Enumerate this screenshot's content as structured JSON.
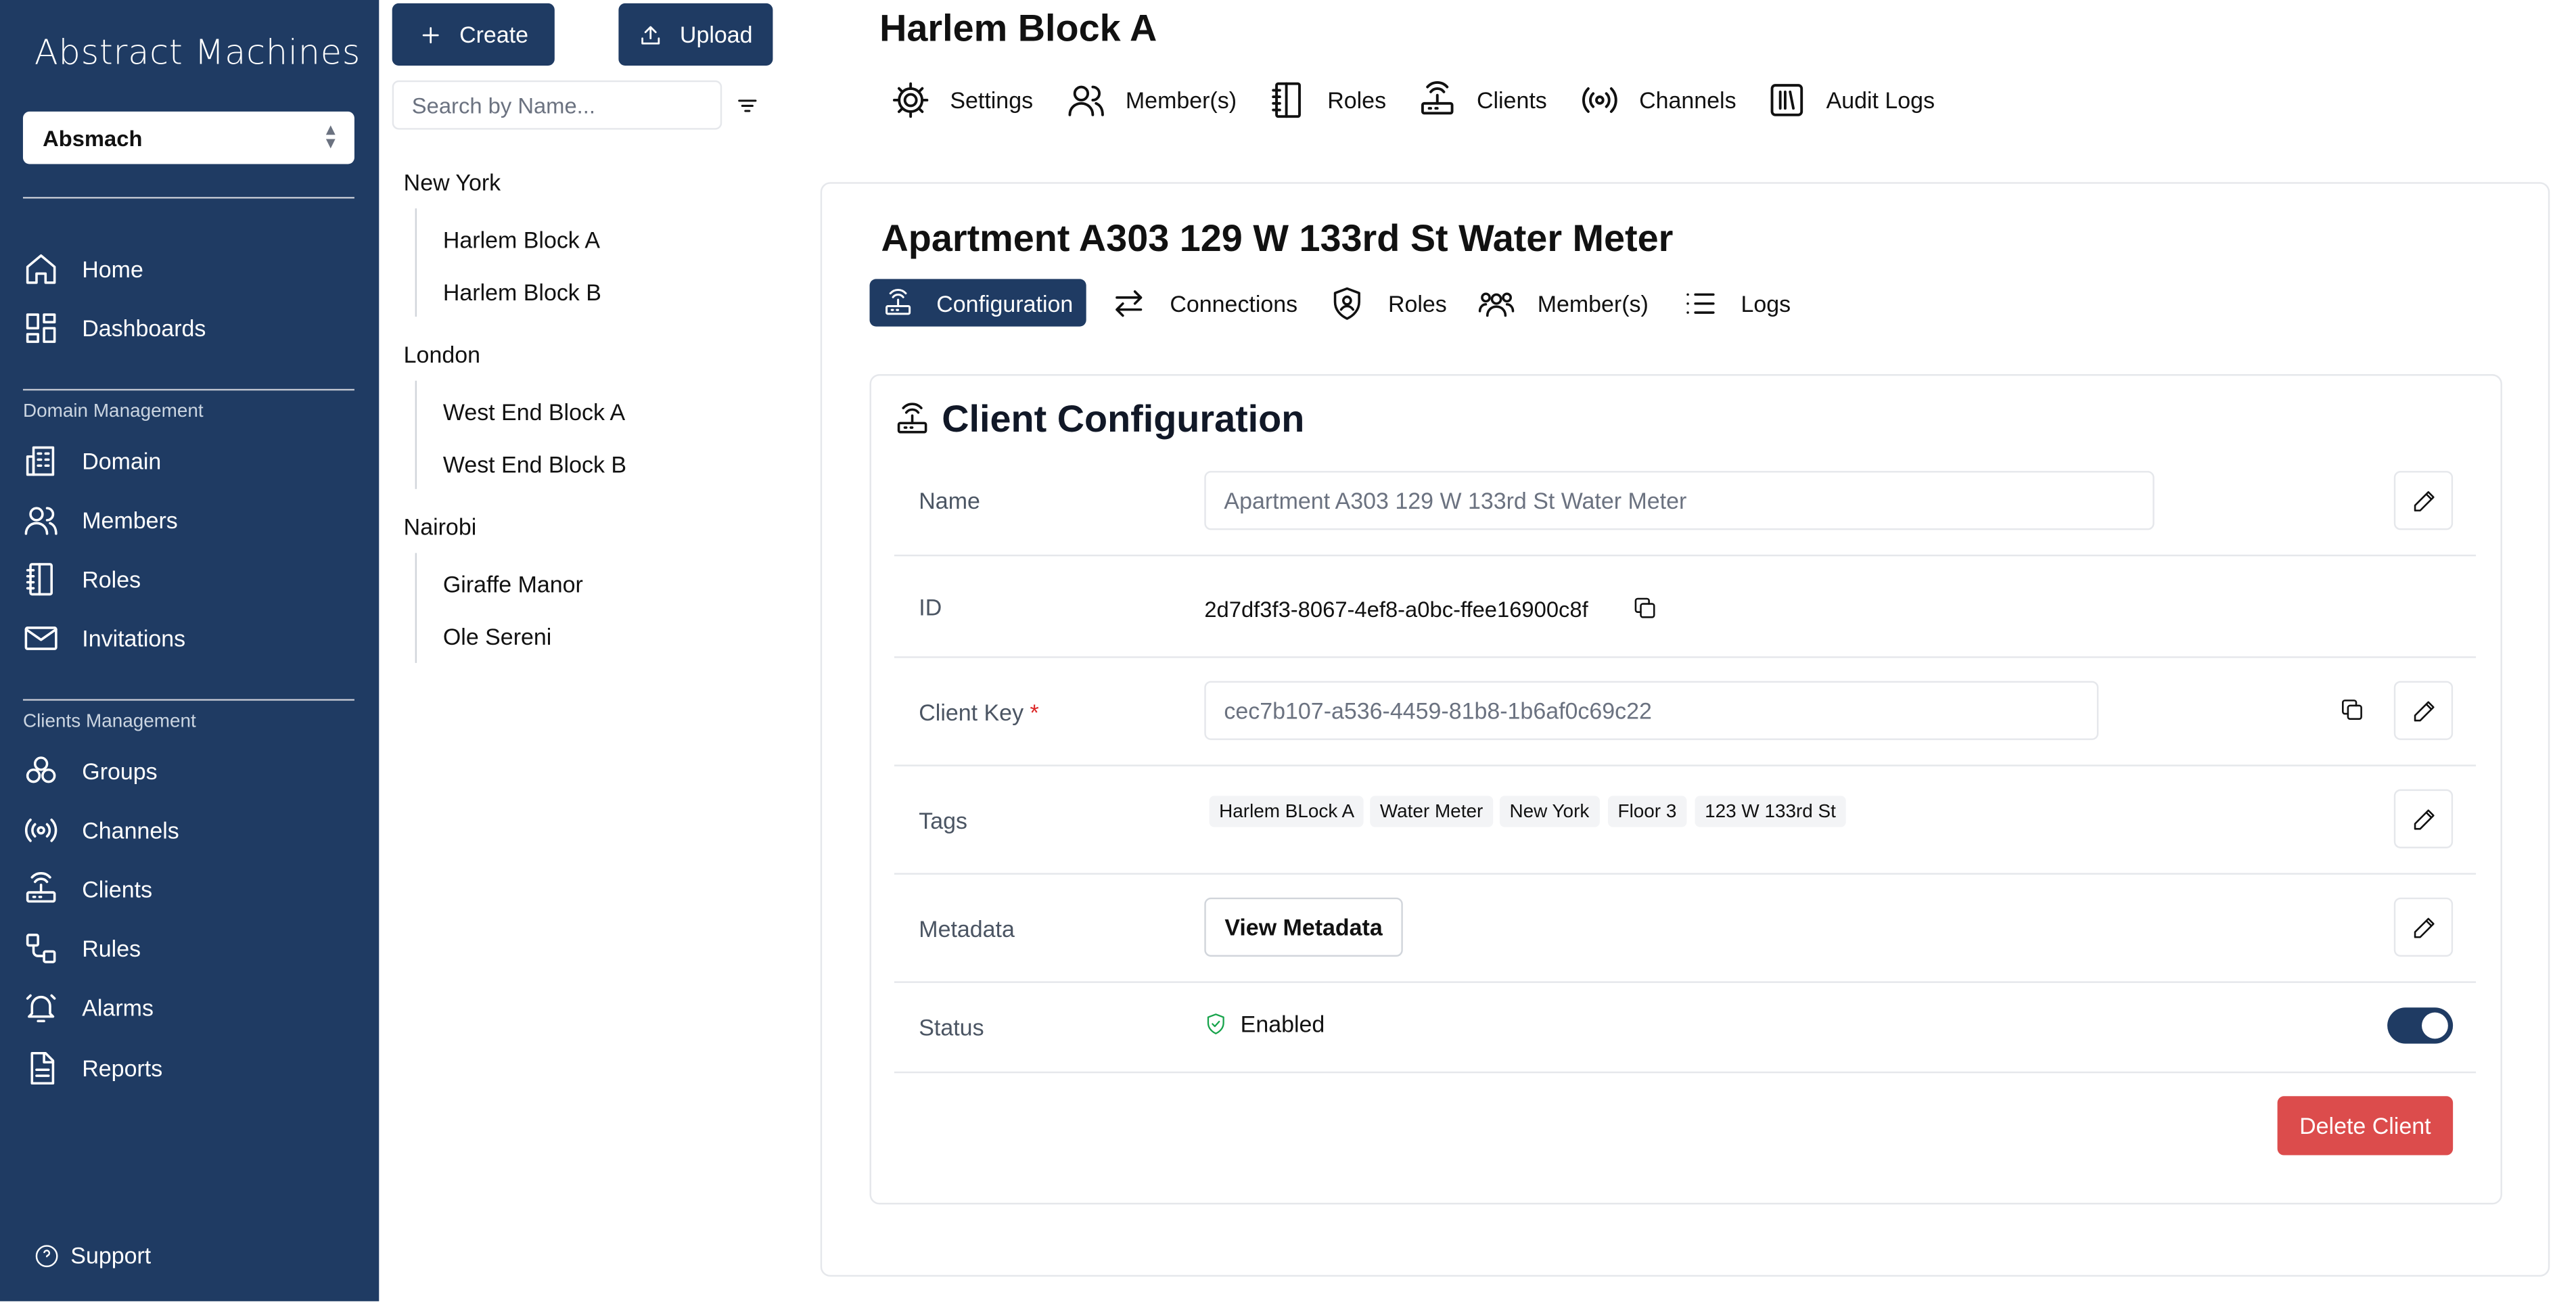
{
  "brand": "Abstract Machines",
  "domain_select": {
    "value": "Absmach"
  },
  "nav": {
    "home": "Home",
    "dashboards": "Dashboards",
    "domain_section": "Domain Management",
    "domain": "Domain",
    "members": "Members",
    "roles": "Roles",
    "invitations": "Invitations",
    "clients_section": "Clients Management",
    "groups": "Groups",
    "channels": "Channels",
    "clients": "Clients",
    "rules": "Rules",
    "alarms": "Alarms",
    "reports": "Reports",
    "support": "Support"
  },
  "tree": {
    "create_label": "Create",
    "upload_label": "Upload",
    "search_placeholder": "Search by Name...",
    "groups": [
      {
        "name": "New York",
        "children": [
          "Harlem Block A",
          "Harlem Block B"
        ]
      },
      {
        "name": "London",
        "children": [
          "West End Block A",
          "West End Block B"
        ]
      },
      {
        "name": "Nairobi",
        "children": [
          "Giraffe Manor",
          "Ole Sereni"
        ]
      }
    ]
  },
  "header": {
    "title": "Harlem Block A",
    "tabs": [
      "Settings",
      "Member(s)",
      "Roles",
      "Clients",
      "Channels",
      "Audit Logs"
    ]
  },
  "client": {
    "title": "Apartment A303 129 W 133rd St Water Meter",
    "tabs": [
      "Configuration",
      "Connections",
      "Roles",
      "Member(s)",
      "Logs"
    ],
    "active_tab": "Configuration",
    "section_title": "Client Configuration",
    "labels": {
      "name": "Name",
      "id": "ID",
      "client_key": "Client Key",
      "required_mark": "*",
      "tags": "Tags",
      "metadata": "Metadata",
      "status": "Status"
    },
    "name_value": "Apartment A303 129 W 133rd St Water Meter",
    "id_value": "2d7df3f3-8067-4ef8-a0bc-ffee16900c8f",
    "client_key_value": "cec7b107-a536-4459-81b8-1b6af0c69c22",
    "tags": [
      "Harlem BLock A",
      "Water Meter",
      "New York",
      "Floor 3",
      "123 W 133rd St"
    ],
    "view_metadata_label": "View Metadata",
    "status_value": "Enabled",
    "status_enabled": true,
    "delete_label": "Delete Client"
  },
  "colors": {
    "sidebar": "#1f3b63",
    "accent": "#1f3b63",
    "danger": "#dc4c4c",
    "status_ok": "#16a34a"
  }
}
